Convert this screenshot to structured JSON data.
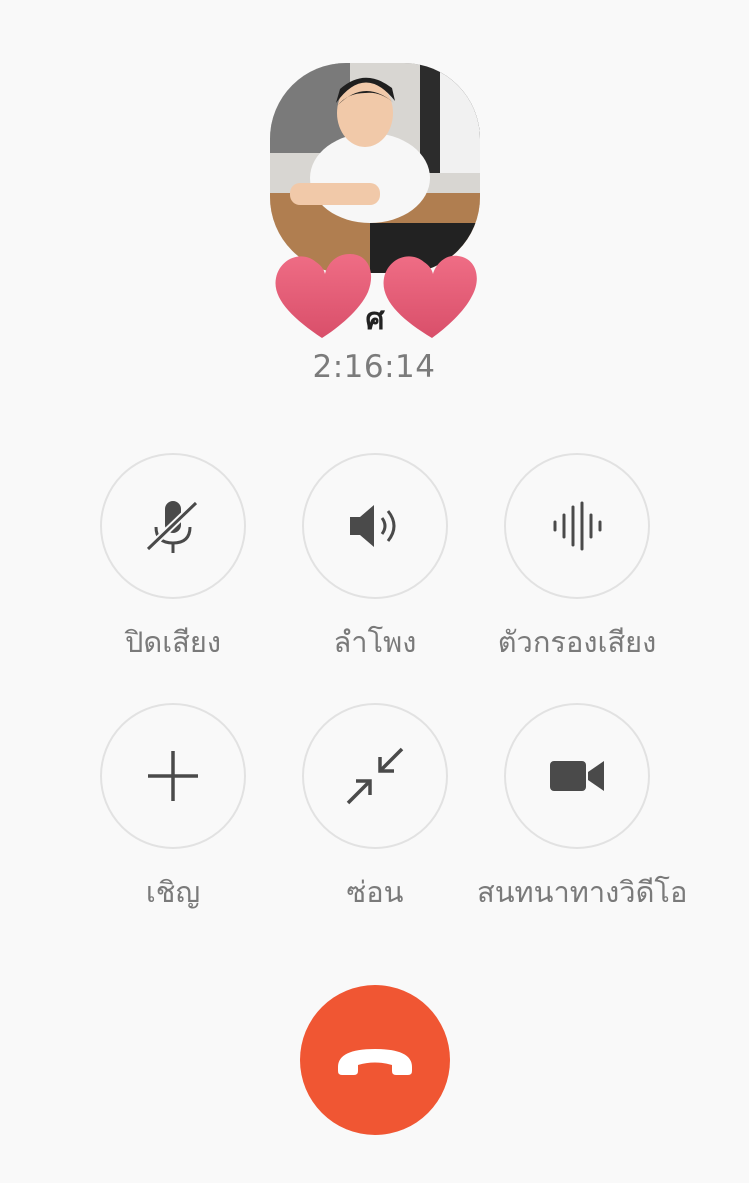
{
  "call": {
    "caller_name": "ศ",
    "duration": "2:16:14"
  },
  "controls": [
    {
      "id": "mute",
      "label": "ปิดเสียง",
      "icon": "mic-off-icon"
    },
    {
      "id": "speaker",
      "label": "ลำโพง",
      "icon": "speaker-icon"
    },
    {
      "id": "noise_filter",
      "label": "ตัวกรองเสียง",
      "icon": "sound-wave-icon"
    },
    {
      "id": "invite",
      "label": "เชิญ",
      "icon": "plus-icon"
    },
    {
      "id": "minimize",
      "label": "ซ่อน",
      "icon": "minimize-icon"
    },
    {
      "id": "video_call",
      "label": "สนทนาทางวิดีโอ",
      "icon": "video-camera-icon"
    }
  ],
  "colors": {
    "end_call": "#f05633",
    "icon": "#4a4a4a",
    "label": "#7a7a7a",
    "heart": "#e8607a"
  }
}
